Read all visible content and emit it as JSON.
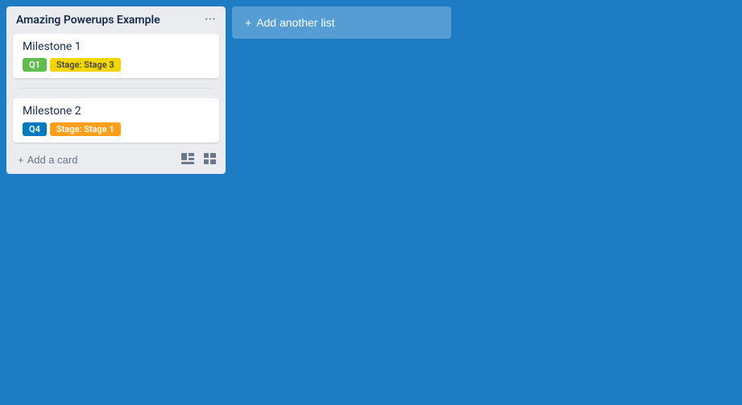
{
  "board": {
    "background_color": "#1d7cc4"
  },
  "list": {
    "title": "Amazing Powerups Example",
    "menu_icon": "···",
    "cards": [
      {
        "id": "card-1",
        "title": "Milestone 1",
        "labels": [
          {
            "id": "label-q1",
            "text": "Q1",
            "color_class": "label-green"
          },
          {
            "id": "label-stage3",
            "text": "Stage: Stage 3",
            "color_class": "label-yellow"
          }
        ]
      },
      {
        "id": "card-2",
        "title": "Milestone 2",
        "labels": [
          {
            "id": "label-q4",
            "text": "Q4",
            "color_class": "label-blue"
          },
          {
            "id": "label-stage1",
            "text": "Stage: Stage 1",
            "color_class": "label-orange"
          }
        ]
      }
    ],
    "add_card_label": "Add a card",
    "footer_icon_1": "▭",
    "footer_icon_2": "⊞"
  },
  "add_list_button": {
    "label": "Add another list",
    "plus_icon": "+"
  }
}
